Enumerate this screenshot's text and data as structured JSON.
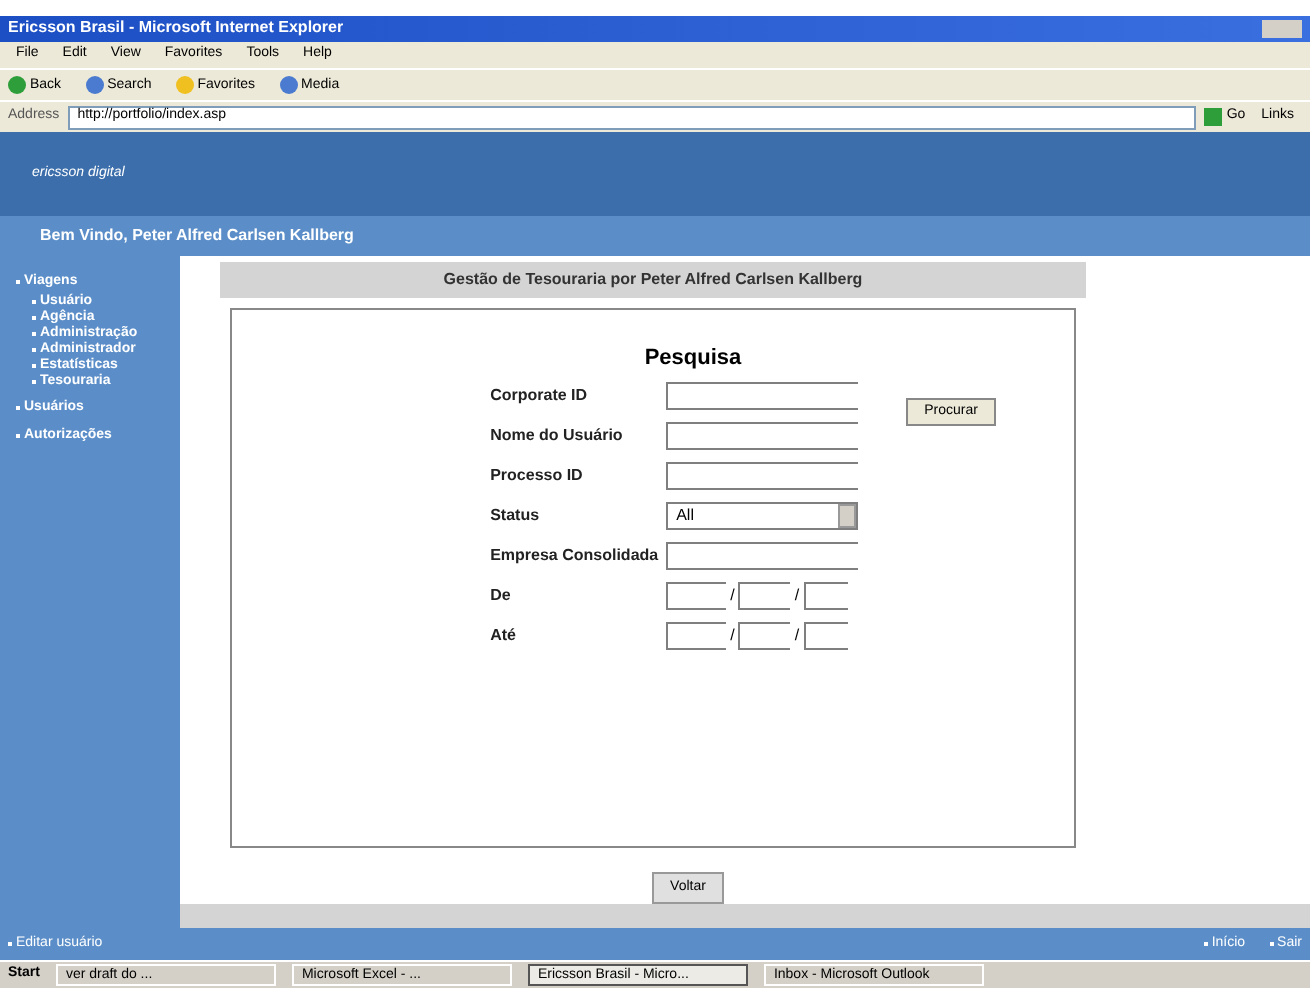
{
  "window": {
    "title": "Ericsson Brasil - Microsoft Internet Explorer"
  },
  "menu": [
    "File",
    "Edit",
    "View",
    "Favorites",
    "Tools",
    "Help"
  ],
  "toolbar": [
    "Back",
    "Search",
    "Favorites",
    "Media"
  ],
  "address": {
    "label": "Address",
    "value": "http://portfolio/index.asp",
    "go": "Go",
    "links": "Links"
  },
  "header": {
    "logo": "ericsson digital",
    "welcome": "Bem Vindo, Peter Alfred Carlsen Kallberg"
  },
  "sidebar": {
    "items": [
      {
        "label": "Viagens",
        "children": [
          {
            "label": "Usuário"
          },
          {
            "label": "Agência"
          },
          {
            "label": "Administração"
          },
          {
            "label": "Administrador"
          },
          {
            "label": "Estatísticas"
          },
          {
            "label": "Tesouraria"
          }
        ]
      },
      {
        "label": "Usuários"
      },
      {
        "label": "Autorizações"
      }
    ]
  },
  "panel": {
    "title": "Gestão de Tesouraria por Peter Alfred Carlsen Kallberg",
    "heading": "Pesquisa",
    "search_button": "Procurar",
    "back_button": "Voltar"
  },
  "fields": [
    {
      "label": "Corporate ID",
      "kind": "text"
    },
    {
      "label": "Nome do Usuário",
      "kind": "text"
    },
    {
      "label": "Processo ID",
      "kind": "text"
    },
    {
      "label": "Status",
      "kind": "select",
      "value": "All"
    },
    {
      "label": "Empresa Consolidada",
      "kind": "text"
    },
    {
      "label": "De",
      "kind": "date",
      "separator": "/"
    },
    {
      "label": "Até",
      "kind": "date",
      "separator": "/"
    }
  ],
  "footer": {
    "left": "Editar usuário",
    "right": [
      "Início",
      "Sair"
    ]
  },
  "taskbar": {
    "start": "Start",
    "items": [
      {
        "label": "ver draft do ...",
        "selected": false
      },
      {
        "label": "Microsoft Excel - ...",
        "selected": false
      },
      {
        "label": "Ericsson Brasil - Micro...",
        "selected": true
      },
      {
        "label": "Inbox - Microsoft Outlook",
        "selected": false
      }
    ]
  }
}
